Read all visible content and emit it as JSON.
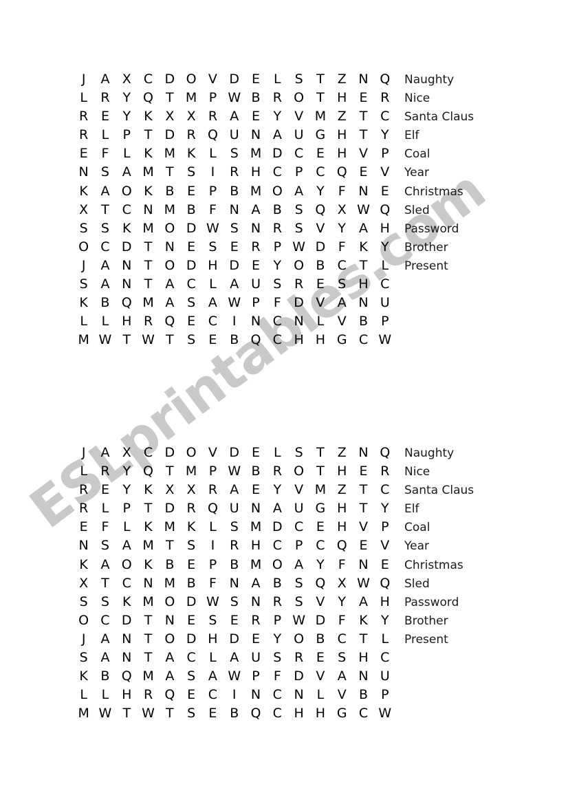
{
  "document": {
    "type": "word-search-worksheet",
    "copies": 2,
    "watermark": "ESLprintables.com",
    "watermark_color": "#c9c9c9",
    "background_color": "#ffffff",
    "text_color": "#000000"
  },
  "puzzle": {
    "rows": 15,
    "columns": 16,
    "grid": [
      [
        "J",
        "A",
        "X",
        "C",
        "D",
        "O",
        "V",
        "D",
        "E",
        "L",
        "S",
        "T",
        "Z",
        "N",
        "Q"
      ],
      [
        "L",
        "R",
        "Y",
        "Q",
        "T",
        "M",
        "P",
        "W",
        "B",
        "R",
        "O",
        "T",
        "H",
        "E",
        "R"
      ],
      [
        "R",
        "E",
        "Y",
        "K",
        "X",
        "X",
        "R",
        "A",
        "E",
        "Y",
        "V",
        "M",
        "Z",
        "T",
        "C"
      ],
      [
        "R",
        "L",
        "P",
        "T",
        "D",
        "R",
        "Q",
        "U",
        "N",
        "A",
        "U",
        "G",
        "H",
        "T",
        "Y"
      ],
      [
        "E",
        "F",
        "L",
        "K",
        "M",
        "K",
        "L",
        "S",
        "M",
        "D",
        "C",
        "E",
        "H",
        "V",
        "P"
      ],
      [
        "N",
        "S",
        "A",
        "M",
        "T",
        "S",
        "I",
        "R",
        "H",
        "C",
        "P",
        "C",
        "Q",
        "E",
        "V"
      ],
      [
        "K",
        "A",
        "O",
        "K",
        "B",
        "E",
        "P",
        "B",
        "M",
        "O",
        "A",
        "Y",
        "F",
        "N",
        "E"
      ],
      [
        "X",
        "T",
        "C",
        "N",
        "M",
        "B",
        "F",
        "N",
        "A",
        "B",
        "S",
        "Q",
        "X",
        "W",
        "Q"
      ],
      [
        "S",
        "S",
        "K",
        "M",
        "O",
        "D",
        "W",
        "S",
        "N",
        "R",
        "S",
        "V",
        "Y",
        "A",
        "H"
      ],
      [
        "O",
        "C",
        "D",
        "T",
        "N",
        "E",
        "S",
        "E",
        "R",
        "P",
        "W",
        "D",
        "F",
        "K",
        "Y"
      ],
      [
        "J",
        "A",
        "N",
        "T",
        "O",
        "D",
        "H",
        "D",
        "E",
        "Y",
        "O",
        "B",
        "C",
        "T",
        "L"
      ],
      [
        "S",
        "A",
        "N",
        "T",
        "A",
        "C",
        "L",
        "A",
        "U",
        "S",
        "R",
        "E",
        "S",
        "H",
        "C"
      ],
      [
        "K",
        "B",
        "Q",
        "M",
        "A",
        "S",
        "A",
        "W",
        "P",
        "F",
        "D",
        "V",
        "A",
        "N",
        "U"
      ],
      [
        "L",
        "L",
        "H",
        "R",
        "Q",
        "E",
        "C",
        "I",
        "N",
        "C",
        "N",
        "L",
        "V",
        "B",
        "P"
      ],
      [
        "M",
        "W",
        "T",
        "W",
        "T",
        "S",
        "E",
        "B",
        "Q",
        "C",
        "H",
        "H",
        "G",
        "C",
        "W"
      ]
    ],
    "words": [
      "Naughty",
      "Nice",
      "Santa Claus",
      "Elf",
      "Coal",
      "Year",
      "Christmas",
      "Sled",
      "Password",
      "Brother",
      "Present"
    ]
  }
}
